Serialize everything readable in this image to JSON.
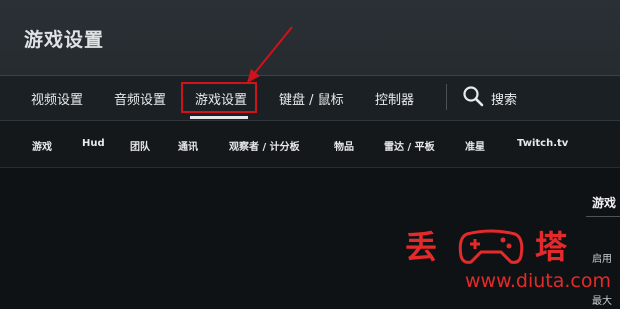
{
  "header": {
    "title": "游戏设置"
  },
  "nav": {
    "tabs": [
      {
        "label": "视频设置"
      },
      {
        "label": "音频设置"
      },
      {
        "label": "游戏设置",
        "active": true
      },
      {
        "label": "键盘 / 鼠标"
      },
      {
        "label": "控制器"
      }
    ],
    "search_label": "搜索",
    "search_icon": "search-icon"
  },
  "subnav": {
    "tabs": [
      "游戏",
      "Hud",
      "团队",
      "通讯",
      "观察者 / 计分板",
      "物品",
      "雷达 / 平板",
      "准星",
      "Twitch.tv"
    ]
  },
  "side_panel": {
    "heading": "游戏",
    "items": [
      "启用",
      "最大"
    ]
  },
  "watermark": {
    "left_char": "丢",
    "right_char": "塔",
    "url": "www.diuta.com"
  },
  "colors": {
    "highlight": "#d0121b",
    "watermark": "#e42a2a"
  }
}
